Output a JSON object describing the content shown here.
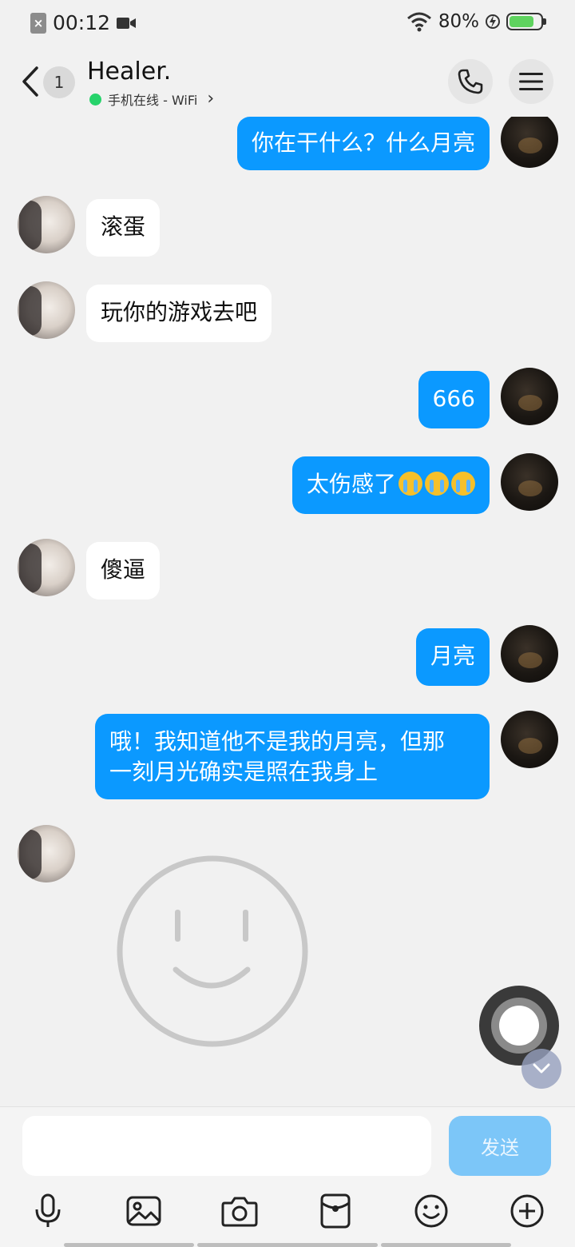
{
  "status_bar": {
    "time": "00:12",
    "battery_text": "80%",
    "battery_level": 0.8,
    "battery_color": "#5fd35f"
  },
  "header": {
    "unread_count": "1",
    "contact_name": "Healer.",
    "status_text": "手机在线 - WiFi",
    "status_chevron": "›",
    "online_color": "#27d36b"
  },
  "messages": [
    {
      "side": "out",
      "text": "你在干什么？什么月亮"
    },
    {
      "side": "in",
      "text": "滚蛋"
    },
    {
      "side": "in",
      "text": "玩你的游戏去吧"
    },
    {
      "side": "out",
      "text": "666"
    },
    {
      "side": "out",
      "text": "太伤感了",
      "emoji": "loudly-crying-face",
      "emoji_count": 3
    },
    {
      "side": "in",
      "text": "傻逼"
    },
    {
      "side": "out",
      "text": "月亮"
    },
    {
      "side": "out",
      "text_line1": "哦！我知道他不是我的月亮，但那",
      "text_line2": "一刻月光确实是照在我身上"
    },
    {
      "side": "in",
      "sticker": "smiley-face-sticker"
    }
  ],
  "input": {
    "value": "",
    "placeholder": "",
    "send_label": "发送"
  },
  "toolbar_icons": [
    "microphone-icon",
    "image-icon",
    "camera-icon",
    "red-packet-icon",
    "emoji-icon",
    "plus-icon"
  ],
  "colors": {
    "out_bubble": "#0b99ff",
    "in_bubble": "#ffffff",
    "background": "#f1f1f1",
    "send_button": "#7cc6f8"
  }
}
